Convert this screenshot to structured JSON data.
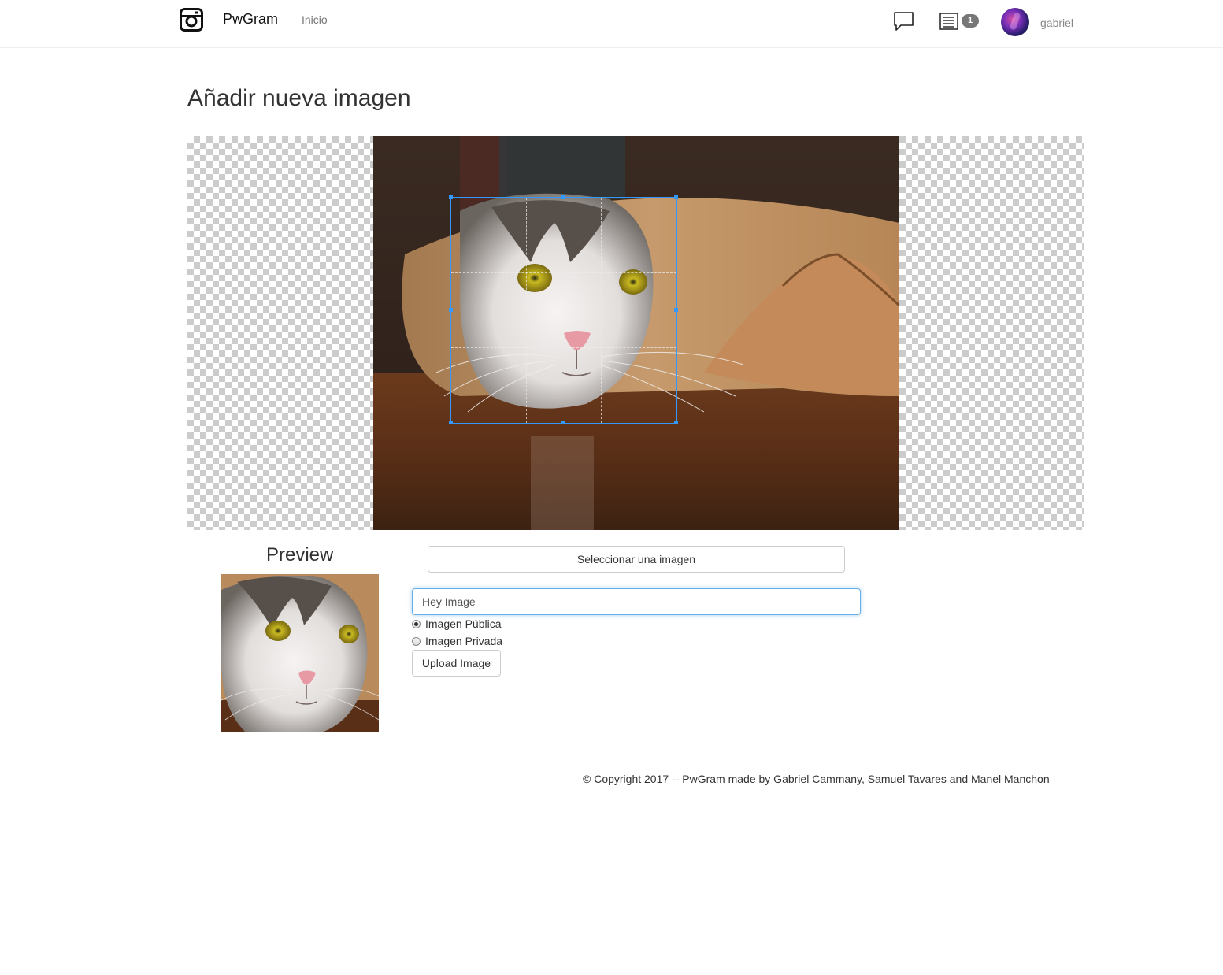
{
  "navbar": {
    "logo_icon": "instagram-camera-icon",
    "brand": "PwGram",
    "home_link": "Inicio",
    "comments_icon": "speech-bubble-icon",
    "notifications_icon": "list-icon",
    "notifications_count": "1",
    "avatar": "galaxy-avatar",
    "username": "gabriel"
  },
  "page": {
    "title": "Añadir nueva imagen"
  },
  "cropper": {
    "photo": "cat-in-paper-roll",
    "transparent_background": "checkerboard"
  },
  "preview": {
    "title": "Preview"
  },
  "form": {
    "select_image_label": "Seleccionar una imagen",
    "title_value": "Hey Image",
    "visibility_options": [
      {
        "label": "Imagen Pública",
        "checked": true
      },
      {
        "label": "Imagen Privada",
        "checked": false
      }
    ],
    "upload_label": "Upload Image"
  },
  "footer": {
    "copyright": "© Copyright 2017 -- PwGram made by Gabriel Cammany, Samuel Tavares and Manel Manchon"
  },
  "colors": {
    "accent_blue": "#3399ff",
    "badge_gray": "#777777",
    "input_focus": "#66afe9"
  }
}
